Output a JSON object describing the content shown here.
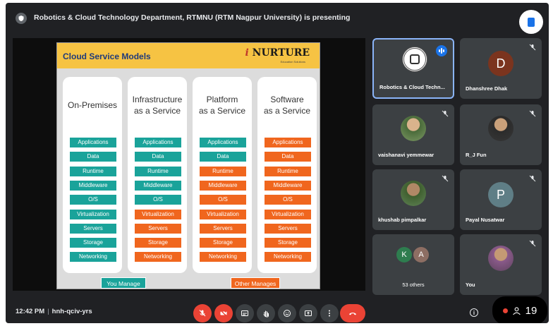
{
  "topbar": {
    "presenting_text": "Robotics & Cloud Technology Department, RTMNU (RTM Nagpur University) is presenting"
  },
  "slide": {
    "title": "Cloud Service Models",
    "brand_i": "i",
    "brand_name": "NURTURE",
    "brand_tagline": "Education Solutions",
    "columns": [
      {
        "title": "On-Premises",
        "cells": [
          "Applications",
          "Data",
          "Runtime",
          "Middleware",
          "O/S",
          "Virtualization",
          "Servers",
          "Storage",
          "Networking"
        ],
        "managed_by": [
          "you",
          "you",
          "you",
          "you",
          "you",
          "you",
          "you",
          "you",
          "you"
        ]
      },
      {
        "title": "Infrastructure\nas a Service",
        "cells": [
          "Applications",
          "Data",
          "Runtime",
          "Middleware",
          "O/S",
          "Virtualization",
          "Servers",
          "Storage",
          "Networking"
        ],
        "managed_by": [
          "you",
          "you",
          "you",
          "you",
          "you",
          "other",
          "other",
          "other",
          "other"
        ]
      },
      {
        "title": "Platform\nas a Service",
        "cells": [
          "Applications",
          "Data",
          "Runtime",
          "Middleware",
          "O/S",
          "Virtualization",
          "Servers",
          "Storage",
          "Networking"
        ],
        "managed_by": [
          "you",
          "you",
          "other",
          "other",
          "other",
          "other",
          "other",
          "other",
          "other"
        ]
      },
      {
        "title": "Software\nas a Service",
        "cells": [
          "Applications",
          "Data",
          "Runtime",
          "Middleware",
          "O/S",
          "Virtualization",
          "Servers",
          "Storage",
          "Networking"
        ],
        "managed_by": [
          "other",
          "other",
          "other",
          "other",
          "other",
          "other",
          "other",
          "other",
          "other"
        ]
      }
    ],
    "legend_you": "You Manage",
    "legend_other": "Other Manages",
    "colors": {
      "you": "#1aa39a",
      "other": "#f0661e"
    }
  },
  "participants": [
    {
      "name": "Robotics & Cloud Techn...",
      "type": "seal",
      "speaking": true
    },
    {
      "name": "Dhanshree Dhak",
      "initial": "D",
      "color": "#7b341e"
    },
    {
      "name": "vaishanavi yemmewar",
      "type": "photo"
    },
    {
      "name": "R_J Fun",
      "type": "photo"
    },
    {
      "name": "khushab pimpalkar",
      "type": "photo"
    },
    {
      "name": "Payal Nusatwar",
      "initial": "P",
      "color": "#5f7e86"
    },
    {
      "name": "53 others",
      "initials": [
        "K",
        "A"
      ],
      "colors": [
        "#2e7d4f",
        "#8d6e63"
      ]
    },
    {
      "name": "You",
      "type": "photo"
    }
  ],
  "bottombar": {
    "time": "12:42 PM",
    "meeting_code": "hnh-qciv-yrs",
    "participant_count": "19",
    "info_label": "i",
    "controls": [
      "mic-off-icon",
      "camera-off-icon",
      "captions-icon",
      "raise-hand-icon",
      "emoji-icon",
      "present-icon",
      "more-icon",
      "end-call-icon"
    ]
  }
}
